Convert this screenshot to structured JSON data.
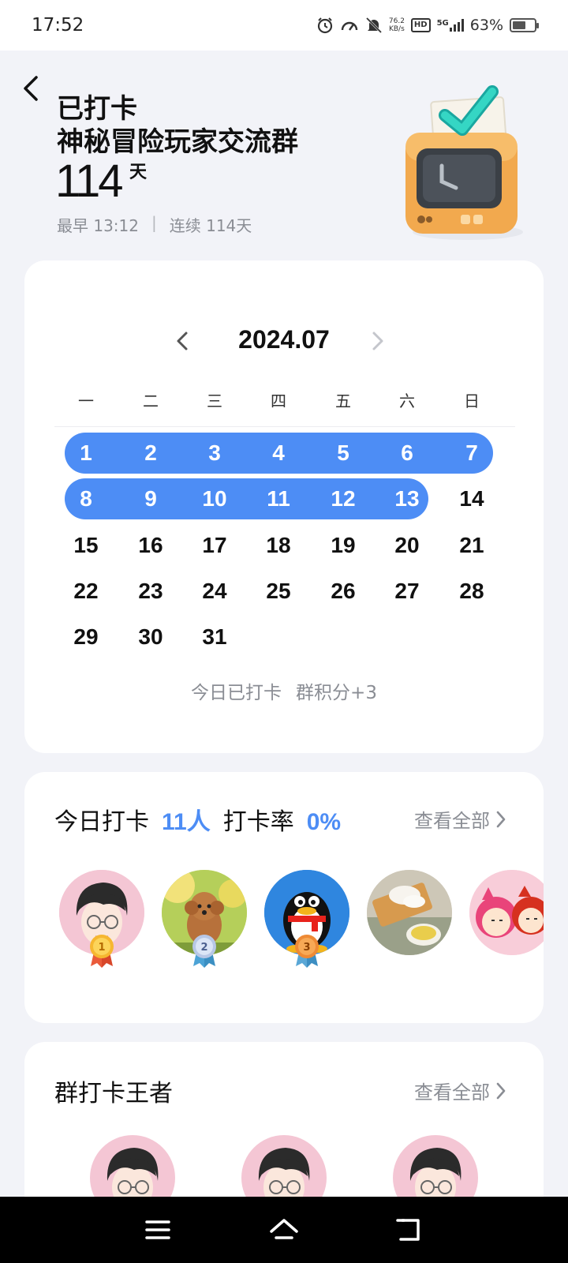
{
  "status_bar": {
    "time": "17:52",
    "net_speed_value": "76.2",
    "net_speed_unit": "KB/s",
    "hd": "HD",
    "signal": "5G",
    "battery": "63%",
    "battery_level": 0.63
  },
  "header": {
    "title": "已打卡",
    "group_name": "神秘冒险玩家交流群",
    "days": "114",
    "days_unit": "天",
    "earliest": "最早 13:12",
    "separator": "|",
    "streak": "连续 114天"
  },
  "calendar": {
    "month": "2024.07",
    "weekdays": [
      "一",
      "二",
      "三",
      "四",
      "五",
      "六",
      "日"
    ],
    "days": [
      "1",
      "2",
      "3",
      "4",
      "5",
      "6",
      "7",
      "8",
      "9",
      "10",
      "11",
      "12",
      "13",
      "14",
      "15",
      "16",
      "17",
      "18",
      "19",
      "20",
      "21",
      "22",
      "23",
      "24",
      "25",
      "26",
      "27",
      "28",
      "29",
      "30",
      "31"
    ],
    "checked_through": 13,
    "footer_status": "今日已打卡",
    "footer_points": "群积分+3"
  },
  "today": {
    "label": "今日打卡",
    "count": "11人",
    "rate_label": "打卡率",
    "rate": "0%",
    "view_all": "查看全部",
    "medals": [
      "1",
      "2",
      "3"
    ]
  },
  "king": {
    "title": "群打卡王者",
    "view_all": "查看全部"
  },
  "colors": {
    "accent": "#4d8df5",
    "background": "#f2f3f8",
    "muted_text": "#8a8d94"
  },
  "icons": [
    "alarm-icon",
    "speed-icon",
    "mute-icon",
    "back-icon",
    "chevron-left-icon",
    "chevron-right-icon",
    "check-icon",
    "menu-icon",
    "home-icon",
    "return-icon"
  ]
}
